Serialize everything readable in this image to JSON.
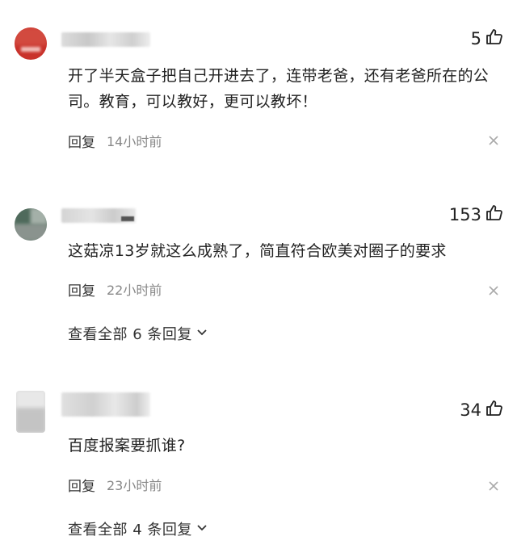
{
  "comments": [
    {
      "likes": "5",
      "text": "开了半天盒子把自己开进去了，连带老爸，还有老爸所在的公司。教育，可以教好，更可以教坏！",
      "reply_label": "回复",
      "time": "14小时前",
      "like_icon": "thumbs-up-icon",
      "close_icon": "close-icon"
    },
    {
      "likes": "153",
      "text": "这菇凉13岁就这么成熟了，简直符合欧美对圈子的要求",
      "reply_label": "回复",
      "time": "22小时前",
      "view_all": "查看全部 6 条回复",
      "like_icon": "thumbs-up-icon",
      "close_icon": "close-icon"
    },
    {
      "likes": "34",
      "text": "百度报案要抓谁?",
      "reply_label": "回复",
      "time": "23小时前",
      "view_all": "查看全部 4 条回复",
      "like_icon": "thumbs-up-icon",
      "close_icon": "close-icon"
    }
  ],
  "colors": {
    "text": "#222222",
    "meta": "#888888",
    "avatar1": "#c9322b",
    "avatar2": "#5a7a6a"
  }
}
